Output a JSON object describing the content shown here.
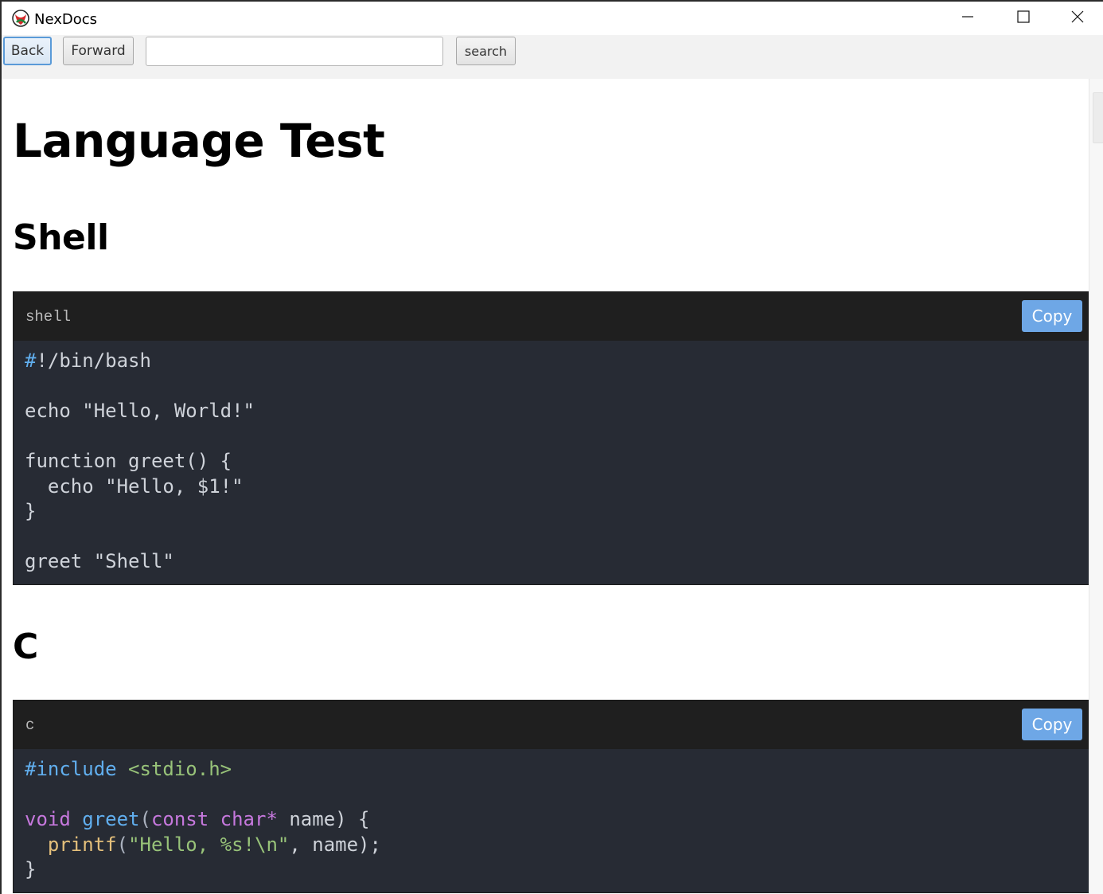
{
  "window": {
    "title": "NexDocs"
  },
  "toolbar": {
    "back_label": "Back",
    "forward_label": "Forward",
    "url_value": "",
    "search_label": "search"
  },
  "page": {
    "title": "Language Test",
    "sections": [
      {
        "heading": "Shell",
        "lang": "shell",
        "copy_label": "Copy",
        "code_lines": [
          "#!/bin/bash",
          "",
          "echo \"Hello, World!\"",
          "",
          "function greet() {",
          "  echo \"Hello, $1!\"",
          "}",
          "",
          "greet \"Shell\""
        ]
      },
      {
        "heading": "C",
        "lang": "c",
        "copy_label": "Copy",
        "code_lines": [
          "#include <stdio.h>",
          "",
          "void greet(const char* name) {",
          "  printf(\"Hello, %s!\\n\", name);",
          "}"
        ]
      }
    ]
  },
  "colors": {
    "code_bg": "#272b34",
    "code_header_bg": "#1f1f1f",
    "copy_button": "#6ea7e6",
    "keyword": "#c678dd",
    "function": "#61afef",
    "string": "#98c379"
  },
  "icons": {
    "app": "nexdocs-logo-icon",
    "minimize": "minimize-icon",
    "maximize": "maximize-icon",
    "close": "close-icon"
  }
}
